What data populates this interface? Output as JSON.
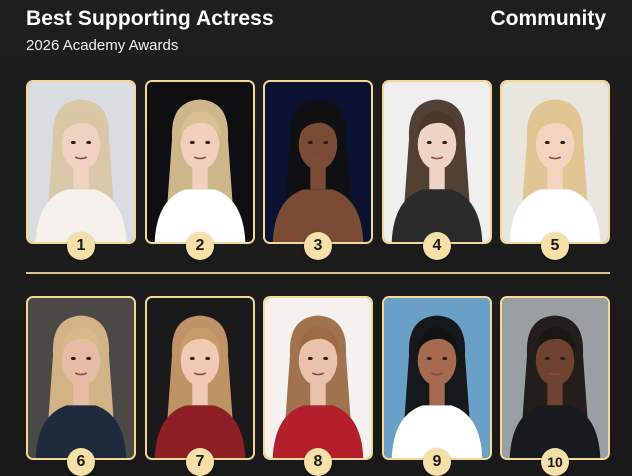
{
  "header": {
    "title": "Best Supporting Actress",
    "subtitle": "2026 Academy Awards",
    "badge": "Community"
  },
  "accent_color": "#f3d896",
  "rows": [
    {
      "items": [
        {
          "rank": "1",
          "bg": "#d9dde1",
          "hair": "#d8c6a4",
          "skin": "#efd2c0",
          "clothes": "#f5f2ee"
        },
        {
          "rank": "2",
          "bg": "#0f0f12",
          "hair": "#d8c091",
          "skin": "#f0d0bd",
          "clothes": "#ffffff"
        },
        {
          "rank": "3",
          "bg": "#0b1230",
          "hair": "#111111",
          "skin": "#7a4b35",
          "clothes": "#7a4b35"
        },
        {
          "rank": "4",
          "bg": "#efefef",
          "hair": "#4a362a",
          "skin": "#efd3c4",
          "clothes": "#2b2b2b"
        },
        {
          "rank": "5",
          "bg": "#e9e5df",
          "hair": "#e0c38f",
          "skin": "#f2d4bf",
          "clothes": "#ffffff"
        }
      ]
    },
    {
      "items": [
        {
          "rank": "6",
          "bg": "#4a4946",
          "hair": "#d9b98a",
          "skin": "#e6bda4",
          "clothes": "#1f2a3d"
        },
        {
          "rank": "7",
          "bg": "#1a1a1a",
          "hair": "#c79a6a",
          "skin": "#efc9b2",
          "clothes": "#8d1f25"
        },
        {
          "rank": "8",
          "bg": "#f4f1ee",
          "hair": "#9c6a45",
          "skin": "#e9c2ab",
          "clothes": "#b3202b"
        },
        {
          "rank": "9",
          "bg": "#6a9fc6",
          "hair": "#121212",
          "skin": "#a46b4f",
          "clothes": "#ffffff"
        },
        {
          "rank": "10",
          "bg": "#9aa0a1",
          "hair": "#1c1614",
          "skin": "#6e4331",
          "clothes": "#171a1e"
        }
      ]
    }
  ]
}
